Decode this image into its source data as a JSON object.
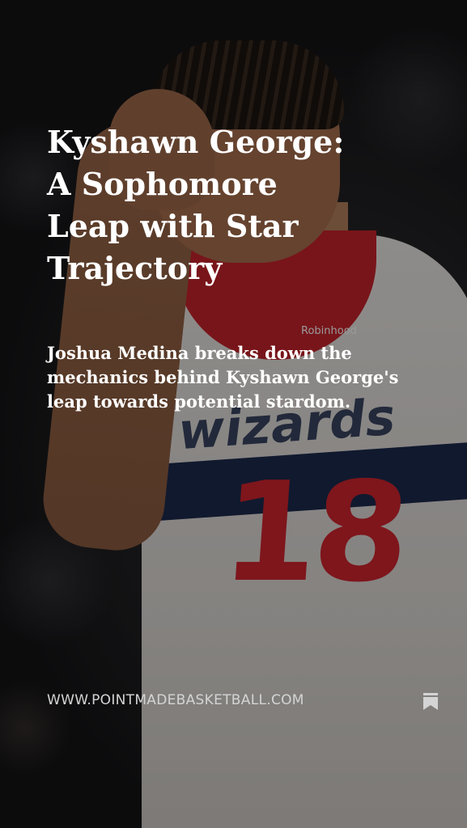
{
  "story": {
    "headline": "Kyshawn George: A Sophomore Leap with Star Trajectory",
    "dek": "Joshua Medina breaks down the mechanics behind Kyshawn George's leap towards potential stardom.",
    "domain": "WWW.POINTMADEBASKETBALL.COM",
    "bookmark_icon": "bookmark-icon"
  },
  "photo": {
    "jersey_team": "wizards",
    "jersey_number": "18",
    "sponsor": "Robinhood"
  },
  "colors": {
    "jersey_red": "#c8232c",
    "jersey_navy": "#1d2a4d",
    "text": "#ffffff",
    "domain_text": "#d4d4d4"
  }
}
